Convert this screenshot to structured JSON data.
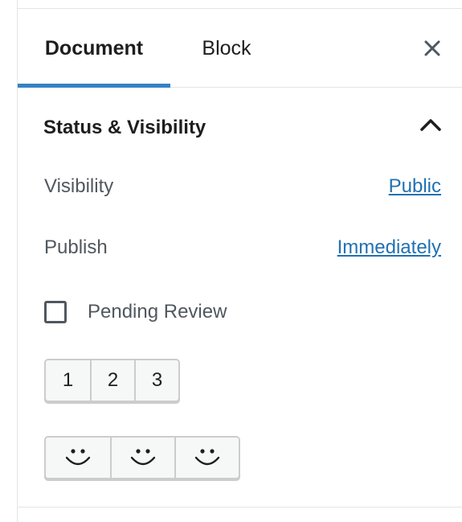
{
  "tabs": {
    "document_label": "Document",
    "block_label": "Block",
    "active": "Document"
  },
  "close": {
    "icon": "close-icon"
  },
  "panel": {
    "title": "Status & Visibility",
    "expanded": true,
    "rows": {
      "visibility_label": "Visibility",
      "visibility_value": "Public",
      "publish_label": "Publish",
      "publish_value": "Immediately"
    },
    "pending_review": {
      "label": "Pending Review",
      "checked": false
    },
    "number_buttons": [
      "1",
      "2",
      "3"
    ],
    "smile_buttons": [
      "smile-icon",
      "smile-icon",
      "smile-icon"
    ]
  },
  "colors": {
    "accent": "#3582c4",
    "link": "#2271b1",
    "text": "#1e1e1e",
    "muted_text": "#50575e",
    "border": "#e2e4e7"
  }
}
